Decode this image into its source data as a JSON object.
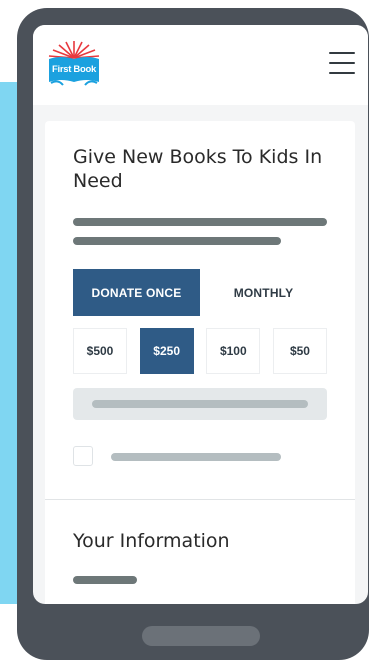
{
  "brand": {
    "logo_text": "First Book",
    "colors": {
      "blue": "#2f5b86",
      "accent": "#7fd6f2",
      "logo_blue": "#1ba1df",
      "logo_red": "#e8393e"
    }
  },
  "header": {
    "menu_icon": "hamburger-menu-icon"
  },
  "form": {
    "title": "Give New Books To Kids In Need",
    "frequency": {
      "selected": "DONATE ONCE",
      "options": [
        "DONATE ONCE",
        "MONTHLY"
      ]
    },
    "amounts": {
      "selected": "$250",
      "options": [
        "$500",
        "$250",
        "$100",
        "$50"
      ]
    }
  },
  "info_section": {
    "title": "Your Information"
  }
}
